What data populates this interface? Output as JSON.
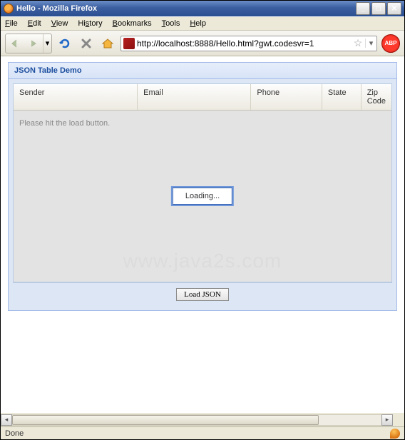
{
  "window": {
    "title": "Hello - Mozilla Firefox"
  },
  "menu": {
    "file": "File",
    "edit": "Edit",
    "view": "View",
    "history": "History",
    "bookmarks": "Bookmarks",
    "tools": "Tools",
    "help": "Help"
  },
  "url": {
    "value": "http://localhost:8888/Hello.html?gwt.codesvr=1"
  },
  "abp": {
    "label": "ABP"
  },
  "panel": {
    "title": "JSON Table Demo"
  },
  "columns": {
    "sender": "Sender",
    "email": "Email",
    "phone": "Phone",
    "state": "State",
    "zip": "Zip Code"
  },
  "body": {
    "hint": "Please hit the load button."
  },
  "loading": {
    "text": "Loading..."
  },
  "footer": {
    "load_label": "Load JSON"
  },
  "status": {
    "text": "Done"
  },
  "watermark": {
    "text": "www.java2s.com"
  }
}
